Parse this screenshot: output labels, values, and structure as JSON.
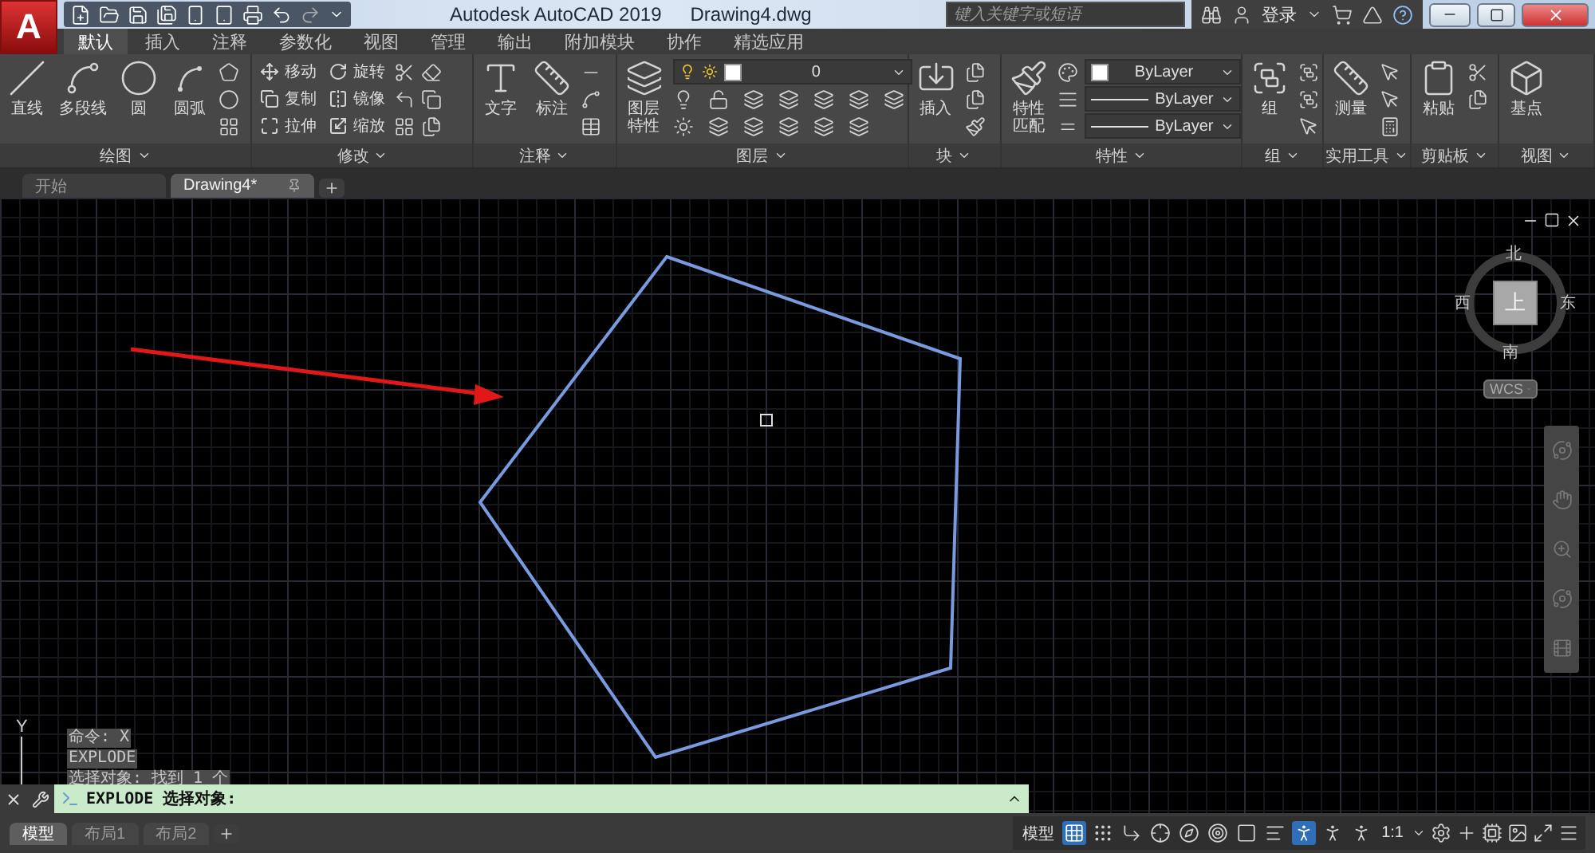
{
  "app_logo": "A",
  "title_bar": {
    "app": "Autodesk AutoCAD 2019",
    "file": "Drawing4.dwg",
    "search_placeholder": "键入关键字或短语",
    "sign_in": "登录"
  },
  "ribbon_tabs": [
    {
      "label": "默认",
      "selected": true
    },
    {
      "label": "插入",
      "selected": false
    },
    {
      "label": "注释",
      "selected": false
    },
    {
      "label": "参数化",
      "selected": false
    },
    {
      "label": "视图",
      "selected": false
    },
    {
      "label": "管理",
      "selected": false
    },
    {
      "label": "输出",
      "selected": false
    },
    {
      "label": "附加模块",
      "selected": false
    },
    {
      "label": "协作",
      "selected": false
    },
    {
      "label": "精选应用",
      "selected": false
    }
  ],
  "ribbon_panels": [
    {
      "title": "绘图",
      "tools": [
        {
          "kind": "large",
          "label": "直线"
        },
        {
          "kind": "large",
          "label": "多段线"
        },
        {
          "kind": "large",
          "label": "圆"
        },
        {
          "kind": "large",
          "label": "圆弧"
        }
      ]
    },
    {
      "title": "修改",
      "tools": [
        {
          "kind": "small",
          "label": "移动"
        },
        {
          "kind": "small",
          "label": "复制"
        },
        {
          "kind": "small",
          "label": "拉伸"
        },
        {
          "kind": "small",
          "label": "旋转"
        },
        {
          "kind": "small",
          "label": "镜像"
        },
        {
          "kind": "small",
          "label": "缩放"
        }
      ]
    },
    {
      "title": "注释",
      "tools": [
        {
          "kind": "large",
          "label": "文字"
        },
        {
          "kind": "large",
          "label": "标注"
        }
      ]
    },
    {
      "title": "图层",
      "tools": [
        {
          "kind": "large",
          "label": "图层特性"
        },
        {
          "kind": "combo",
          "value": "0"
        }
      ]
    },
    {
      "title": "块",
      "tools": [
        {
          "kind": "large",
          "label": "插入"
        }
      ]
    },
    {
      "title": "特性",
      "tools": [
        {
          "kind": "large",
          "label": "特性匹配"
        },
        {
          "kind": "combo",
          "value": "ByLayer"
        },
        {
          "kind": "combo",
          "value": "ByLayer"
        },
        {
          "kind": "combo",
          "value": "ByLayer"
        }
      ]
    },
    {
      "title": "组",
      "tools": [
        {
          "kind": "large",
          "label": "组"
        }
      ]
    },
    {
      "title": "实用工具",
      "tools": [
        {
          "kind": "large",
          "label": "测量"
        }
      ]
    },
    {
      "title": "剪贴板",
      "tools": [
        {
          "kind": "large",
          "label": "粘贴"
        }
      ]
    },
    {
      "title": "视图",
      "tools": [
        {
          "kind": "large",
          "label": "基点"
        }
      ]
    }
  ],
  "file_tabs": [
    {
      "label": "开始",
      "selected": false
    },
    {
      "label": "Drawing4*",
      "selected": true
    }
  ],
  "viewcube": {
    "north": "北",
    "south": "南",
    "west": "西",
    "east": "东",
    "face": "上",
    "ucs": "WCS"
  },
  "ucs_axis": "Y",
  "command_history": [
    "命令: X",
    "EXPLODE",
    "选择对象: 找到 1 个"
  ],
  "command_prompt": "EXPLODE 选择对象:",
  "layout_tabs": [
    {
      "label": "模型",
      "selected": true
    },
    {
      "label": "布局1",
      "selected": false
    },
    {
      "label": "布局2",
      "selected": false
    }
  ],
  "status_bar": {
    "space": "模型",
    "scale": "1:1",
    "toggles": [
      {
        "on": true
      },
      {
        "on": false
      },
      {
        "on": false
      },
      {
        "on": false
      },
      {
        "on": false
      },
      {
        "on": false
      },
      {
        "on": false
      },
      {
        "on": false
      },
      {
        "on": true
      },
      {
        "on": false
      },
      {
        "on": false
      }
    ]
  }
}
